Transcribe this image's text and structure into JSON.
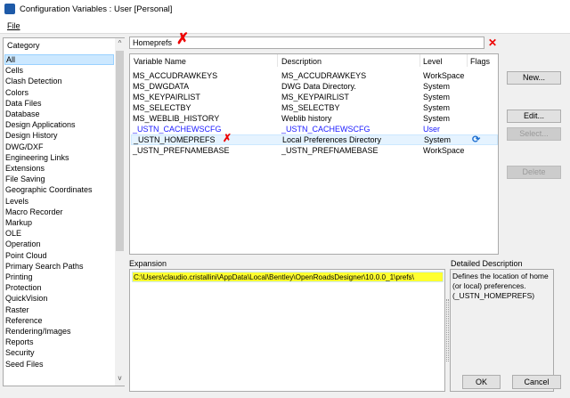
{
  "window": {
    "title": "Configuration Variables : User [Personal]"
  },
  "menu": {
    "file": "File"
  },
  "category": {
    "header": "Category",
    "items": [
      "All",
      "Cells",
      "Clash Detection",
      "Colors",
      "Data Files",
      "Database",
      "Design Applications",
      "Design History",
      "DWG/DXF",
      "Engineering Links",
      "Extensions",
      "File Saving",
      "Geographic Coordinates",
      "Levels",
      "Macro Recorder",
      "Markup",
      "OLE",
      "Operation",
      "Point Cloud",
      "Primary Search Paths",
      "Printing",
      "Protection",
      "QuickVision",
      "Raster",
      "Reference",
      "Rendering/Images",
      "Reports",
      "Security",
      "Seed Files"
    ],
    "selected": "All"
  },
  "filter": {
    "value": "Homeprefs",
    "annotation": "✗"
  },
  "variables": {
    "columns": [
      "Variable Name",
      "Description",
      "Level",
      "Flags"
    ],
    "rows": [
      {
        "name": "MS_ACCUDRAWKEYS",
        "description": "MS_ACCUDRAWKEYS",
        "level": "WorkSpace"
      },
      {
        "name": "MS_DWGDATA",
        "description": "DWG Data Directory.",
        "level": "System"
      },
      {
        "name": "MS_KEYPAIRLIST",
        "description": "MS_KEYPAIRLIST",
        "level": "System"
      },
      {
        "name": "MS_SELECTBY",
        "description": "MS_SELECTBY",
        "level": "System"
      },
      {
        "name": "MS_WEBLIB_HISTORY",
        "description": "Weblib history",
        "level": "System"
      },
      {
        "name": "_USTN_CACHEWSCFG",
        "description": "_USTN_CACHEWSCFG",
        "level": "User",
        "color": "#1a1aff"
      },
      {
        "name": "_USTN_HOMEPREFS",
        "description": "Local Preferences Directory",
        "level": "System",
        "flag": "refresh-icon",
        "selected": true
      },
      {
        "name": "_USTN_PREFNAMEBASE",
        "description": "_USTN_PREFNAMEBASE",
        "level": "WorkSpace"
      }
    ]
  },
  "buttons": {
    "new": "New...",
    "edit": "Edit...",
    "select": "Select...",
    "delete": "Delete",
    "ok": "OK",
    "cancel": "Cancel"
  },
  "expansion": {
    "label": "Expansion",
    "value": "C:\\Users\\claudio.cristallini\\AppData\\Local\\Bentley\\OpenRoadsDesigner\\10.0.0_1\\prefs\\",
    "highlight": "#ffff30"
  },
  "detail": {
    "label": "Detailed Description",
    "text": "Defines the location of home (or local) preferences. (_USTN_HOMEPREFS)"
  }
}
